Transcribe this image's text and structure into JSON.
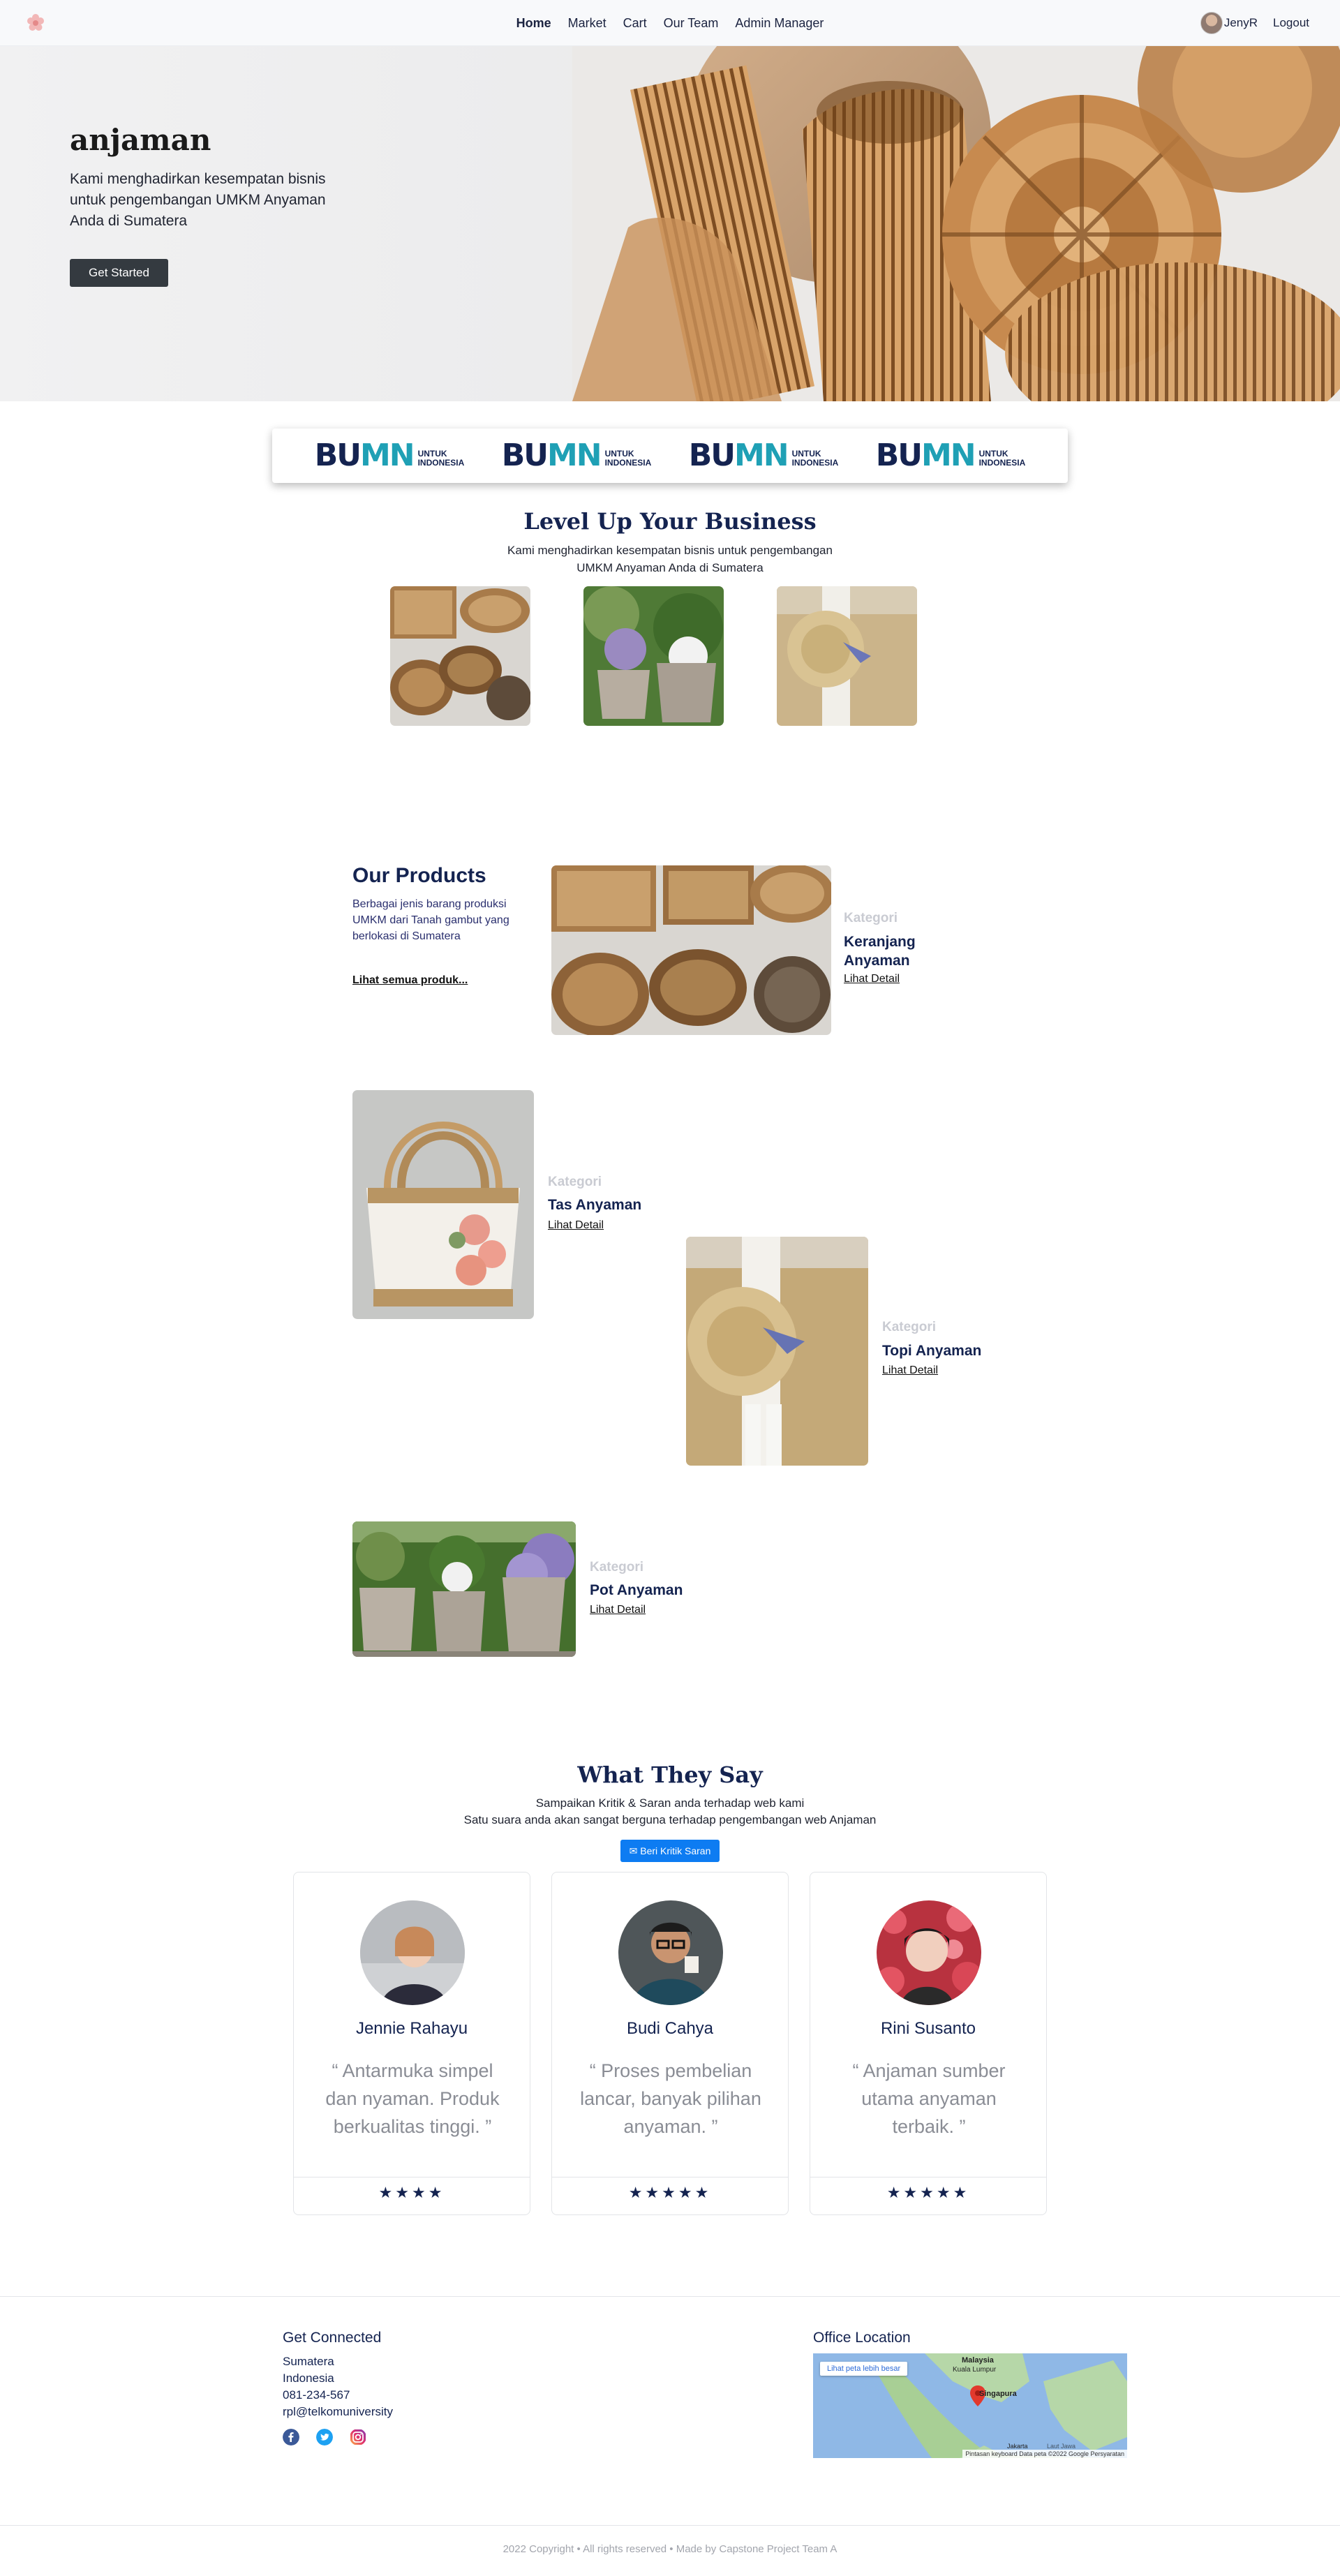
{
  "nav": {
    "links": [
      "Home",
      "Market",
      "Cart",
      "Our Team",
      "Admin Manager"
    ],
    "user_name": "JenyR",
    "logout": "Logout"
  },
  "hero": {
    "title": "anjaman",
    "description": "Kami menghadirkan kesempatan bisnis untuk pengembangan UMKM Anyaman Anda di Sumatera",
    "button": "Get Started"
  },
  "partners": {
    "logos": [
      {
        "mark_left": "BU",
        "mark_right": "MN",
        "sub1": "UNTUK",
        "sub2": "INDONESIA"
      },
      {
        "mark_left": "BU",
        "mark_right": "MN",
        "sub1": "UNTUK",
        "sub2": "INDONESIA"
      },
      {
        "mark_left": "BU",
        "mark_right": "MN",
        "sub1": "UNTUK",
        "sub2": "INDONESIA"
      },
      {
        "mark_left": "BU",
        "mark_right": "MN",
        "sub1": "UNTUK",
        "sub2": "INDONESIA"
      }
    ]
  },
  "levelup": {
    "title": "Level Up Your Business",
    "subtitle": "Kami menghadirkan kesempatan bisnis untuk pengembangan UMKM Anyaman Anda di Sumatera"
  },
  "products": {
    "heading": "Our Products",
    "description": "Berbagai jenis barang produksi UMKM dari Tanah gambut yang berlokasi di Sumatera",
    "see_all": "Lihat semua produk...",
    "items": [
      {
        "category": "Kategori",
        "name": "Keranjang Anyaman",
        "link": "Lihat Detail"
      },
      {
        "category": "Kategori",
        "name": "Tas Anyaman",
        "link": "Lihat Detail"
      },
      {
        "category": "Kategori",
        "name": "Topi Anyaman",
        "link": "Lihat Detail"
      },
      {
        "category": "Kategori",
        "name": "Pot Anyaman",
        "link": "Lihat Detail"
      }
    ]
  },
  "testimonials": {
    "title": "What They Say",
    "subtitle_line1": "Sampaikan Kritik & Saran anda terhadap web kami",
    "subtitle_line2": "Satu suara anda akan sangat berguna terhadap pengembangan web Anjaman",
    "button": "Beri Kritik Saran",
    "cards": [
      {
        "name": "Jennie Rahayu",
        "quote": "“ Antarmuka simpel dan nyaman. Produk berkualitas tinggi. ”",
        "stars": "★★★★",
        "rating": 4
      },
      {
        "name": "Budi Cahya",
        "quote": "“ Proses pembelian lancar, banyak pilihan anyaman. ”",
        "stars": "★★★★★",
        "rating": 5
      },
      {
        "name": "Rini Susanto",
        "quote": "“ Anjaman sumber utama anyaman terbaik. ”",
        "stars": "★★★★★",
        "rating": 5
      }
    ]
  },
  "footer": {
    "connect_title": "Get Connected",
    "contact": [
      "Sumatera",
      "Indonesia",
      "081-234-567",
      "rpl@telkomuniversity"
    ],
    "office_title": "Office Location",
    "map": {
      "button": "Lihat peta lebih besar",
      "labels": [
        "Malaysia",
        "Kuala Lumpur",
        "Singapura",
        "Jakarta",
        "Laut Jawa"
      ],
      "attribution": "Pintasan keyboard  Data peta ©2022 Google  Persyaratan"
    },
    "copyright": "2022 Copyright • All rights reserved • Made by Capstone Project Team A"
  },
  "colors": {
    "navy": "#142350",
    "teal": "#1fa0b5",
    "button_dark": "#343a40",
    "button_blue": "#0d7cf2"
  },
  "icons": [
    "flower-logo-icon",
    "comment-icon",
    "facebook-icon",
    "twitter-icon",
    "instagram-icon",
    "map-pin-icon"
  ]
}
